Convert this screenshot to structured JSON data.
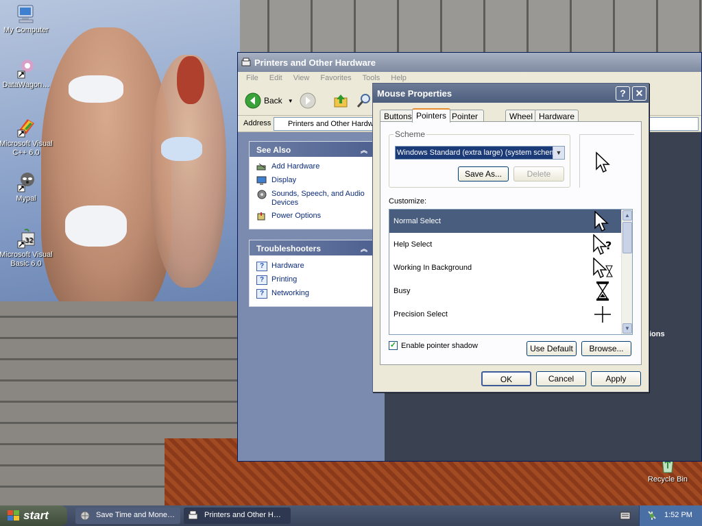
{
  "desktop": {
    "icons": [
      {
        "label": "My Computer",
        "icon": "my-computer-icon"
      },
      {
        "label": "DataWagon…",
        "icon": "datawagon-shortcut-icon"
      },
      {
        "label": "Microsoft Visual C++ 6.0",
        "icon": "visual-cpp-shortcut-icon"
      },
      {
        "label": "Mypal",
        "icon": "mypal-shortcut-icon"
      },
      {
        "label": "Microsoft Visual Basic 6.0",
        "icon": "visual-basic-shortcut-icon"
      },
      {
        "label": "Recycle Bin",
        "icon": "recycle-bin-icon"
      }
    ]
  },
  "explorer": {
    "title": "Printers and Other Hardware",
    "menu": [
      "File",
      "Edit",
      "View",
      "Favorites",
      "Tools",
      "Help"
    ],
    "toolbar": {
      "back": "Back"
    },
    "address": {
      "label": "Address",
      "value": "Printers and Other Hardware"
    },
    "see_also": {
      "title": "See Also",
      "items": [
        "Add Hardware",
        "Display",
        "Sounds, Speech, and Audio Devices",
        "Power Options"
      ]
    },
    "troubleshooters": {
      "title": "Troubleshooters",
      "items": [
        "Hardware",
        "Printing",
        "Networking"
      ]
    },
    "right_partial_text": "ions"
  },
  "dialog": {
    "title": "Mouse Properties",
    "tabs": [
      "Buttons",
      "Pointers",
      "Pointer Options",
      "Wheel",
      "Hardware"
    ],
    "active_tab": "Pointers",
    "scheme": {
      "label": "Scheme",
      "selected": "Windows Standard (extra large) (system scheme)",
      "save_as": "Save As...",
      "delete": "Delete"
    },
    "customize_label": "Customize:",
    "pointers": [
      {
        "name": "Normal Select",
        "cursor": "arrow-cursor-icon",
        "selected": true
      },
      {
        "name": "Help Select",
        "cursor": "help-cursor-icon"
      },
      {
        "name": "Working In Background",
        "cursor": "working-cursor-icon"
      },
      {
        "name": "Busy",
        "cursor": "hourglass-cursor-icon"
      },
      {
        "name": "Precision Select",
        "cursor": "crosshair-cursor-icon"
      }
    ],
    "shadow_label": "Enable pointer shadow",
    "shadow_checked": true,
    "use_default": "Use Default",
    "browse": "Browse...",
    "ok": "OK",
    "cancel": "Cancel",
    "apply": "Apply"
  },
  "taskbar": {
    "start": "start",
    "items": [
      "Save Time and Mone…",
      "Printers and Other H…"
    ],
    "clock": "1:52 PM"
  }
}
